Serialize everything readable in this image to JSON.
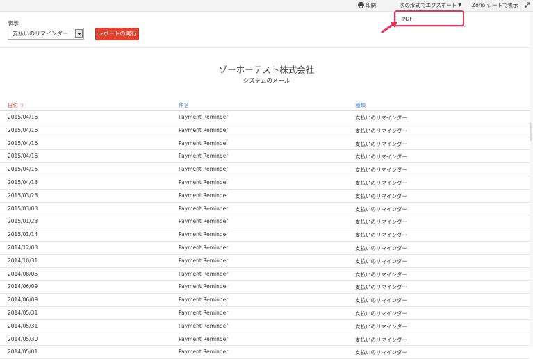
{
  "toolbar": {
    "print_label": "印刷",
    "export_label": "次の形式でエクスポート",
    "sheet_label": "Zoho シートで表示"
  },
  "export_menu": {
    "items": [
      "PDF"
    ]
  },
  "filter": {
    "label": "表示",
    "selected": "支払いのリマインダー",
    "run_label": "レポートの実行"
  },
  "report": {
    "company": "ゾーホーテスト株式会社",
    "title": "システムのメール"
  },
  "table": {
    "columns": [
      "日付",
      "件名",
      "種類"
    ],
    "rows": [
      [
        "2015/04/16",
        "Payment Reminder",
        "支払いのリマインダー"
      ],
      [
        "2015/04/16",
        "Payment Reminder",
        "支払いのリマインダー"
      ],
      [
        "2015/04/16",
        "Payment Reminder",
        "支払いのリマインダー"
      ],
      [
        "2015/04/16",
        "Payment Reminder",
        "支払いのリマインダー"
      ],
      [
        "2015/04/15",
        "Payment Reminder",
        "支払いのリマインダー"
      ],
      [
        "2015/04/13",
        "Payment Reminder",
        "支払いのリマインダー"
      ],
      [
        "2015/03/23",
        "Payment Reminder",
        "支払いのリマインダー"
      ],
      [
        "2015/03/03",
        "Payment Reminder",
        "支払いのリマインダー"
      ],
      [
        "2015/01/23",
        "Payment Reminder",
        "支払いのリマインダー"
      ],
      [
        "2015/01/14",
        "Payment Reminder",
        "支払いのリマインダー"
      ],
      [
        "2014/12/03",
        "Payment Reminder",
        "支払いのリマインダー"
      ],
      [
        "2014/10/31",
        "Payment Reminder",
        "支払いのリマインダー"
      ],
      [
        "2014/08/05",
        "Payment Reminder",
        "支払いのリマインダー"
      ],
      [
        "2014/06/09",
        "Payment Reminder",
        "支払いのリマインダー"
      ],
      [
        "2014/06/09",
        "Payment Reminder",
        "支払いのリマインダー"
      ],
      [
        "2014/05/31",
        "Payment Reminder",
        "支払いのリマインダー"
      ],
      [
        "2014/05/31",
        "Payment Reminder",
        "支払いのリマインダー"
      ],
      [
        "2014/05/30",
        "Payment Reminder",
        "支払いのリマインダー"
      ],
      [
        "2014/05/01",
        "Payment Reminder",
        "支払いのリマインダー"
      ]
    ]
  },
  "icons": {
    "print": "printer-icon",
    "sort": "sort-icon",
    "expand": "expand-icon",
    "dropdown": "chevron-down-icon"
  },
  "colors": {
    "accent_red": "#e0432f",
    "link_blue": "#4a86c5",
    "highlight": "#e8355d"
  }
}
